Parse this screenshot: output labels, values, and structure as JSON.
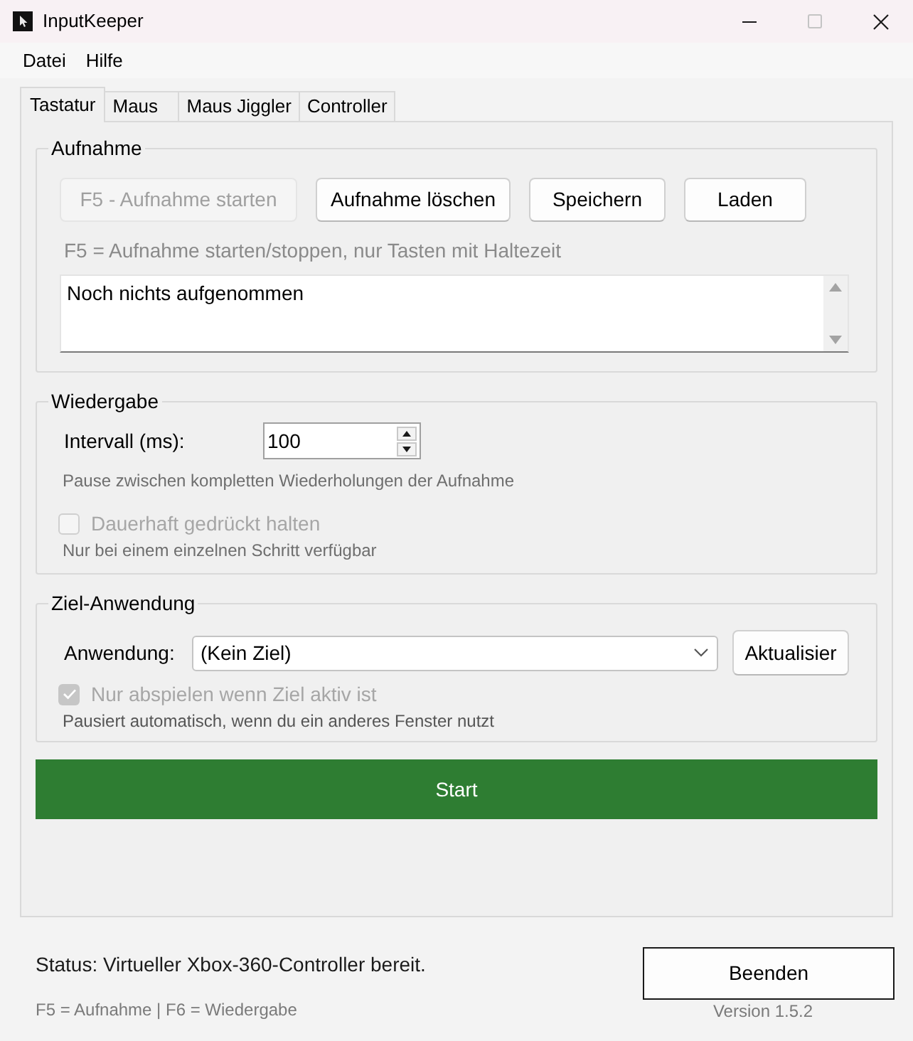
{
  "window": {
    "title": "InputKeeper",
    "maximize_disabled": true
  },
  "menu": [
    {
      "label": "Datei"
    },
    {
      "label": "Hilfe"
    }
  ],
  "tabs": [
    {
      "label": "Tastatur",
      "selected": true
    },
    {
      "label": "Maus",
      "selected": false
    },
    {
      "label": "Maus Jiggler",
      "selected": false
    },
    {
      "label": "Controller",
      "selected": false
    }
  ],
  "recording": {
    "title": "Aufnahme",
    "buttons": [
      {
        "label": "F5 - Aufnahme starten",
        "disabled": true
      },
      {
        "label": "Aufnahme löschen",
        "disabled": false
      },
      {
        "label": "Speichern",
        "disabled": false
      },
      {
        "label": "Laden",
        "disabled": false
      }
    ],
    "hint": "F5 = Aufnahme starten/stoppen, nur Tasten mit Haltezeit",
    "log": {
      "value": "Noch nichts aufgenommen"
    }
  },
  "playback": {
    "title": "Wiedergabe",
    "interval": {
      "label": "Intervall (ms):",
      "value": "100"
    },
    "interval_hint": "Pause zwischen kompletten Wiederholungen der Aufnahme",
    "hold": {
      "label": "Dauerhaft gedrückt halten",
      "checked": false,
      "disabled": true
    },
    "hold_hint": "Nur bei einem einzelnen Schritt verfügbar"
  },
  "target": {
    "title": "Ziel-Anwendung",
    "application": {
      "label": "Anwendung:",
      "value": "(Kein Ziel)"
    },
    "refresh_button": {
      "label": "Aktualisier"
    },
    "only_active": {
      "label": "Nur abspielen wenn Ziel aktiv ist",
      "checked": true,
      "disabled": true
    },
    "only_active_hint": "Pausiert automatisch, wenn du ein anderes Fenster nutzt"
  },
  "start_button": {
    "label": "Start"
  },
  "status_bar": {
    "status": "Status: Virtueller Xbox-360-Controller bereit.",
    "shortcuts": "F5 = Aufnahme | F6 = Wiedergabe",
    "quit_button": {
      "label": "Beenden"
    },
    "version": "Version 1.5.2"
  }
}
